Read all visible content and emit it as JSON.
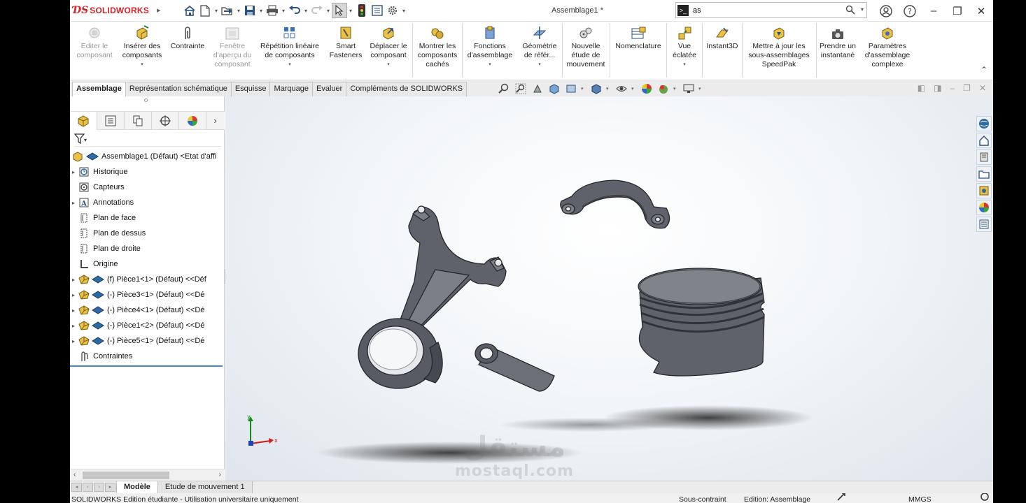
{
  "app": {
    "logo_ds": "ƊS",
    "logo_name": "SOLIDWORKS",
    "document_title": "Assemblage1 *",
    "search_value": "as"
  },
  "colors": {
    "brand_red": "#d2232a",
    "accent_blue": "#4a86c8",
    "part_grey": "#6d7079",
    "viewport_bg": "#eef2f6"
  },
  "quick_access": [
    {
      "name": "home-icon"
    },
    {
      "name": "new-document-icon"
    },
    {
      "name": "open-folder-icon"
    },
    {
      "name": "save-icon"
    },
    {
      "name": "print-icon"
    },
    {
      "name": "undo-icon"
    },
    {
      "name": "redo-icon"
    },
    {
      "name": "select-cursor-icon"
    },
    {
      "name": "rebuild-traffic-light-icon"
    },
    {
      "name": "file-properties-icon"
    },
    {
      "name": "options-gear-icon"
    }
  ],
  "ribbon": {
    "edit_component": "Editer le composant",
    "insert_components": "Insérer des composants",
    "mate": "Contrainte",
    "component_preview": "Fenêtre d'aperçu du composant",
    "linear_pattern": "Répétition linéaire de composants",
    "smart_fasteners": "Smart Fasteners",
    "move_component": "Déplacer le composant",
    "show_hidden": "Montrer les composants cachés",
    "assembly_features": "Fonctions d'assemblage",
    "reference_geometry": "Géométrie de référ...",
    "new_motion_study": "Nouvelle étude de mouvement",
    "bom": "Nomenclature",
    "exploded_view": "Vue éclatée",
    "instant3d": "Instant3D",
    "update_speedpak": "Mettre à jour les sous-assemblages SpeedPak",
    "take_snapshot": "Prendre un instantané",
    "large_assembly": "Paramètres d'assemblage complexe"
  },
  "tabs": [
    "Assemblage",
    "Représentation schématique",
    "Esquisse",
    "Marquage",
    "Evaluer",
    "Compléments de SOLIDWORKS"
  ],
  "tree": {
    "root": "Assemblage1 (Défaut) <Etat d'affi",
    "items": [
      {
        "label": "Historique",
        "icon": "history-icon",
        "expand": "▸"
      },
      {
        "label": "Capteurs",
        "icon": "sensors-icon",
        "expand": ""
      },
      {
        "label": "Annotations",
        "icon": "annotations-icon",
        "expand": "▸"
      },
      {
        "label": "Plan de face",
        "icon": "plane-icon",
        "expand": ""
      },
      {
        "label": "Plan de dessus",
        "icon": "plane-icon",
        "expand": ""
      },
      {
        "label": "Plan de droite",
        "icon": "plane-icon",
        "expand": ""
      },
      {
        "label": "Origine",
        "icon": "origin-icon",
        "expand": ""
      }
    ],
    "parts": [
      "(f) Pièce1<1> (Défaut) <<Déf",
      "(-) Pièce3<1> (Défaut) <<Dé",
      "(-) Pièce4<1> (Défaut) <<Dé",
      "(-) Pièce1<2> (Défaut) <<Dé",
      "(-) Pièce5<1> (Défaut) <<Dé"
    ],
    "mates": "Contraintes"
  },
  "bottom_tabs": [
    "Modèle",
    "Etude de mouvement 1"
  ],
  "status": {
    "edition": "SOLIDWORKS Edition étudiante - Utilisation universitaire uniquement",
    "constraint": "Sous-contraint",
    "mode": "Edition: Assemblage",
    "units": "MMGS"
  },
  "watermark": {
    "arabic": "مستقل",
    "latin": "mostaql.com"
  }
}
